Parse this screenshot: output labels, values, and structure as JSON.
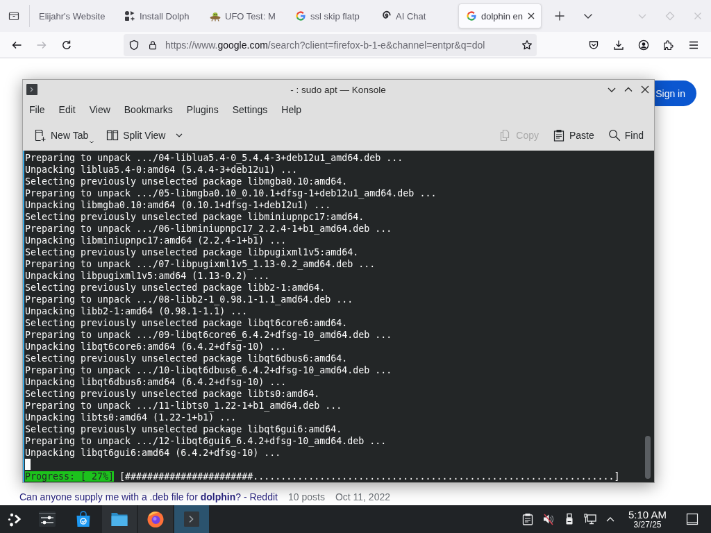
{
  "browser": {
    "tabs": [
      {
        "title": "Elijahr's Website",
        "kind": "plain",
        "selected": false
      },
      {
        "title": "Install Dolph",
        "kind": "store",
        "selected": false
      },
      {
        "title": "UFO Test: M",
        "kind": "ufo",
        "selected": false
      },
      {
        "title": "ssl skip flatp",
        "kind": "google",
        "selected": false
      },
      {
        "title": "AI Chat",
        "kind": "chat",
        "selected": false
      },
      {
        "title": "dolphin en",
        "kind": "google",
        "selected": true
      }
    ],
    "url": "https://www.**google.com**/search?client=firefox-b-1-e&channel=entpr&q=dol"
  },
  "page": {
    "sign_in": "Sign in",
    "result": {
      "title": "Can anyone supply me with a .deb file for **dolphin**? - Reddit",
      "posts": "10 posts",
      "date": "Oct 11, 2022"
    }
  },
  "konsole": {
    "title": "- : sudo apt — Konsole",
    "menu": [
      "File",
      "Edit",
      "View",
      "Bookmarks",
      "Plugins",
      "Settings",
      "Help"
    ],
    "toolbar": {
      "left": [
        {
          "label": "New Tab",
          "kind": "new-tab",
          "disabled": false
        },
        {
          "label": "Split View",
          "kind": "split-view",
          "disabled": false
        }
      ],
      "right": [
        {
          "label": "Copy",
          "kind": "copy",
          "disabled": true
        },
        {
          "label": "Paste",
          "kind": "paste",
          "disabled": false
        },
        {
          "label": "Find",
          "kind": "find",
          "disabled": false
        }
      ]
    },
    "lines": [
      "Preparing to unpack .../04-liblua5.4-0_5.4.4-3+deb12u1_amd64.deb ...",
      "Unpacking liblua5.4-0:amd64 (5.4.4-3+deb12u1) ...",
      "Selecting previously unselected package libmgba0.10:amd64.",
      "Preparing to unpack .../05-libmgba0.10_0.10.1+dfsg-1+deb12u1_amd64.deb ...",
      "Unpacking libmgba0.10:amd64 (0.10.1+dfsg-1+deb12u1) ...",
      "Selecting previously unselected package libminiupnpc17:amd64.",
      "Preparing to unpack .../06-libminiupnpc17_2.2.4-1+b1_amd64.deb ...",
      "Unpacking libminiupnpc17:amd64 (2.2.4-1+b1) ...",
      "Selecting previously unselected package libpugixml1v5:amd64.",
      "Preparing to unpack .../07-libpugixml1v5_1.13-0.2_amd64.deb ...",
      "Unpacking libpugixml1v5:amd64 (1.13-0.2) ...",
      "Selecting previously unselected package libb2-1:amd64.",
      "Preparing to unpack .../08-libb2-1_0.98.1-1.1_amd64.deb ...",
      "Unpacking libb2-1:amd64 (0.98.1-1.1) ...",
      "Selecting previously unselected package libqt6core6:amd64.",
      "Preparing to unpack .../09-libqt6core6_6.4.2+dfsg-10_amd64.deb ...",
      "Unpacking libqt6core6:amd64 (6.4.2+dfsg-10) ...",
      "Selecting previously unselected package libqt6dbus6:amd64.",
      "Preparing to unpack .../10-libqt6dbus6_6.4.2+dfsg-10_amd64.deb ...",
      "Unpacking libqt6dbus6:amd64 (6.4.2+dfsg-10) ...",
      "Selecting previously unselected package libts0:amd64.",
      "Preparing to unpack .../11-libts0_1.22-1+b1_amd64.deb ...",
      "Unpacking libts0:amd64 (1.22-1+b1) ...",
      "Selecting previously unselected package libqt6gui6:amd64.",
      "Preparing to unpack .../12-libqt6gui6_6.4.2+dfsg-10_amd64.deb ...",
      "Unpacking libqt6gui6:amd64 (6.4.2+dfsg-10) ..."
    ],
    "progress": {
      "label": "Progress: [ 27%]",
      "bar": "[#######################.................................................................]"
    }
  },
  "taskbar": {
    "apps": [
      {
        "kind": "settings",
        "open": false,
        "selected": false
      },
      {
        "kind": "store",
        "open": false,
        "selected": false
      },
      {
        "kind": "files",
        "open": true,
        "selected": false
      },
      {
        "kind": "browser",
        "open": true,
        "selected": false
      },
      {
        "kind": "terminal",
        "open": true,
        "selected": true
      }
    ],
    "time": "5:10 AM",
    "date": "3/27/25"
  }
}
